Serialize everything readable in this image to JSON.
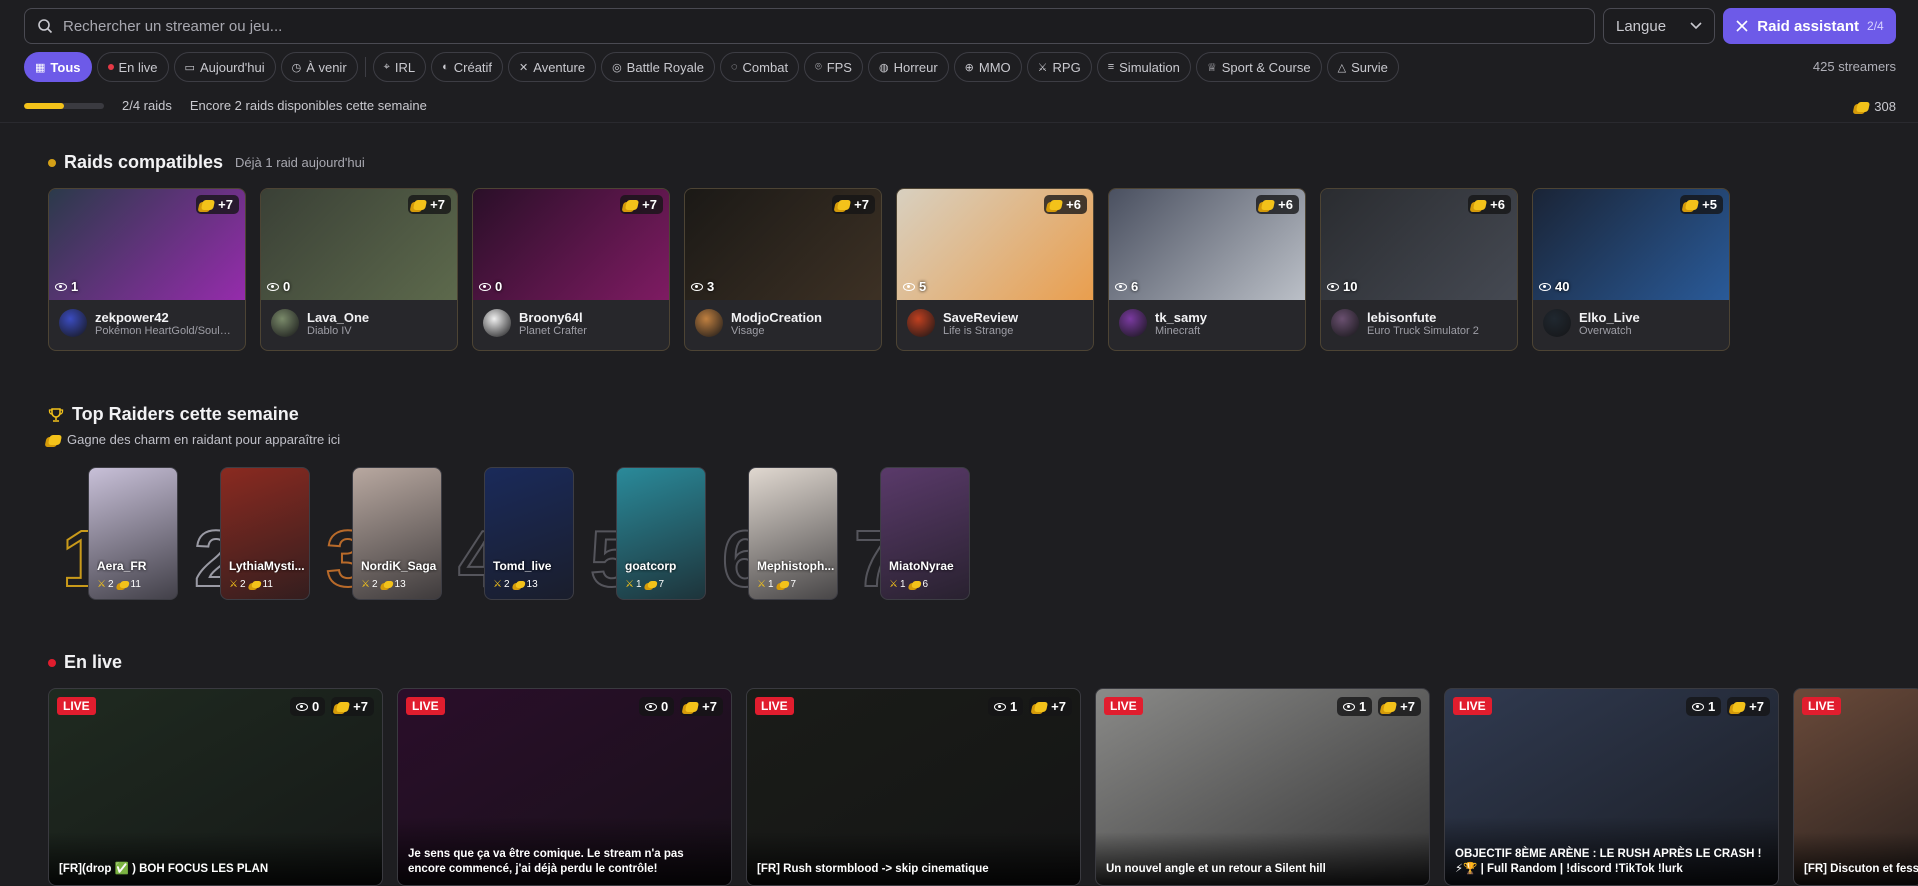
{
  "search": {
    "placeholder": "Rechercher un streamer ou jeu..."
  },
  "language": {
    "label": "Langue"
  },
  "raid_button": {
    "label": "Raid assistant",
    "count": "2/4"
  },
  "filters": [
    {
      "label": "Tous",
      "icon": "grid-icon",
      "active": true
    },
    {
      "label": "En live",
      "icon": "live-dot-icon"
    },
    {
      "label": "Aujourd'hui",
      "icon": "calendar-icon"
    },
    {
      "label": "À venir",
      "icon": "clock-icon"
    },
    {
      "label": "IRL",
      "icon": "pin-icon"
    },
    {
      "label": "Créatif",
      "icon": "palette-icon"
    },
    {
      "label": "Aventure",
      "icon": "compass-icon"
    },
    {
      "label": "Battle Royale",
      "icon": "target-icon"
    },
    {
      "label": "Combat",
      "icon": "fist-icon"
    },
    {
      "label": "FPS",
      "icon": "crosshair-icon"
    },
    {
      "label": "Horreur",
      "icon": "ghost-icon"
    },
    {
      "label": "MMO",
      "icon": "globe-icon"
    },
    {
      "label": "RPG",
      "icon": "sword-icon"
    },
    {
      "label": "Simulation",
      "icon": "sliders-icon"
    },
    {
      "label": "Sport & Course",
      "icon": "trophy-icon"
    },
    {
      "label": "Survie",
      "icon": "tent-icon"
    }
  ],
  "streamer_count": "425 streamers",
  "progress": {
    "fraction": 0.5,
    "label": "2/4 raids",
    "message": "Encore 2 raids disponibles cette semaine"
  },
  "charm_total": "308",
  "compatible": {
    "title": "Raids compatibles",
    "subtitle": "Déjà 1 raid aujourd'hui",
    "cards": [
      {
        "name": "zekpower42",
        "game": "Pokémon HeartGold/SoulSilver",
        "viewers": "1",
        "boost": "+7",
        "thumb": "#2b3a4a",
        "accent": "#c026d3",
        "avatar": "#3b4cc0"
      },
      {
        "name": "Lava_One",
        "game": "Diablo IV",
        "viewers": "0",
        "boost": "+7",
        "thumb": "#3a4036",
        "accent": "#6b7a55",
        "avatar": "#7a8a6a"
      },
      {
        "name": "Broony64l",
        "game": "Planet Crafter",
        "viewers": "0",
        "boost": "+7",
        "thumb": "#2a0f28",
        "accent": "#a0207a",
        "avatar": "#f0f0f0"
      },
      {
        "name": "ModjoCreation",
        "game": "Visage",
        "viewers": "3",
        "boost": "+7",
        "thumb": "#1b1916",
        "accent": "#4a3a2a",
        "avatar": "#c08040"
      },
      {
        "name": "SaveReview",
        "game": "Life is Strange",
        "viewers": "5",
        "boost": "+6",
        "thumb": "#d8d0c0",
        "accent": "#f08a20",
        "avatar": "#c04020"
      },
      {
        "name": "tk_samy",
        "game": "Minecraft",
        "viewers": "6",
        "boost": "+6",
        "thumb": "#4a5060",
        "accent": "#e8ecf0",
        "avatar": "#7a3aa0"
      },
      {
        "name": "lebisonfute",
        "game": "Euro Truck Simulator 2",
        "viewers": "10",
        "boost": "+6",
        "thumb": "#2a2c30",
        "accent": "#505560",
        "avatar": "#6a5070"
      },
      {
        "name": "Elko_Live",
        "game": "Overwatch",
        "viewers": "40",
        "boost": "+5",
        "thumb": "#1a2436",
        "accent": "#3070c0",
        "avatar": "#202830"
      }
    ]
  },
  "top_raiders": {
    "title": "Top Raiders cette semaine",
    "subtitle": "Gagne des charm en raidant pour apparaître ici",
    "raiders": [
      {
        "rank": "1",
        "name": "Aera_FR",
        "raids": "2",
        "charms": "11",
        "bg": "#c8c0d8",
        "tier": "gold"
      },
      {
        "rank": "2",
        "name": "LythiaMysti...",
        "raids": "2",
        "charms": "11",
        "bg": "#8a2a20",
        "tier": "silver"
      },
      {
        "rank": "3",
        "name": "NordiK_Saga",
        "raids": "2",
        "charms": "13",
        "bg": "#b8a8a0",
        "tier": "bronze"
      },
      {
        "rank": "4",
        "name": "Tomd_live",
        "raids": "2",
        "charms": "13",
        "bg": "#1a2a5a",
        "tier": ""
      },
      {
        "rank": "5",
        "name": "goatcorp",
        "raids": "1",
        "charms": "7",
        "bg": "#2a8a9a",
        "tier": ""
      },
      {
        "rank": "6",
        "name": "Mephistoph...",
        "raids": "1",
        "charms": "7",
        "bg": "#e0d8d0",
        "tier": ""
      },
      {
        "rank": "7",
        "name": "MiatoNyrae",
        "raids": "1",
        "charms": "6",
        "bg": "#5a3a6a",
        "tier": ""
      }
    ]
  },
  "live": {
    "title": "En live",
    "badge": "LIVE",
    "cards": [
      {
        "title": "[FR](drop ✅ ) BOH FOCUS LES PLAN",
        "viewers": "0",
        "boost": "+7",
        "bg": "#1f2a20"
      },
      {
        "title": "Je sens que ça va être comique. Le stream n'a pas encore commencé, j'ai déjà perdu le contrôle!",
        "viewers": "0",
        "boost": "+7",
        "bg": "#2a0e2a"
      },
      {
        "title": "[FR] Rush stormblood -> skip cinematique",
        "viewers": "1",
        "boost": "+7",
        "bg": "#1a1c18"
      },
      {
        "title": "Un nouvel angle et un retour a Silent hill",
        "viewers": "1",
        "boost": "+7",
        "bg": "#8a8a88"
      },
      {
        "title": "OBJECTIF 8ÈME ARÈNE : LE RUSH APRÈS LE CRASH ! ⚡🏆 | Full Random | !discord !TikTok !lurk",
        "viewers": "1",
        "boost": "+7",
        "bg": "#303a50"
      },
      {
        "title": "[FR] Discuton et fesson",
        "viewers": "",
        "boost": "",
        "bg": "#6a4a3a"
      }
    ]
  }
}
